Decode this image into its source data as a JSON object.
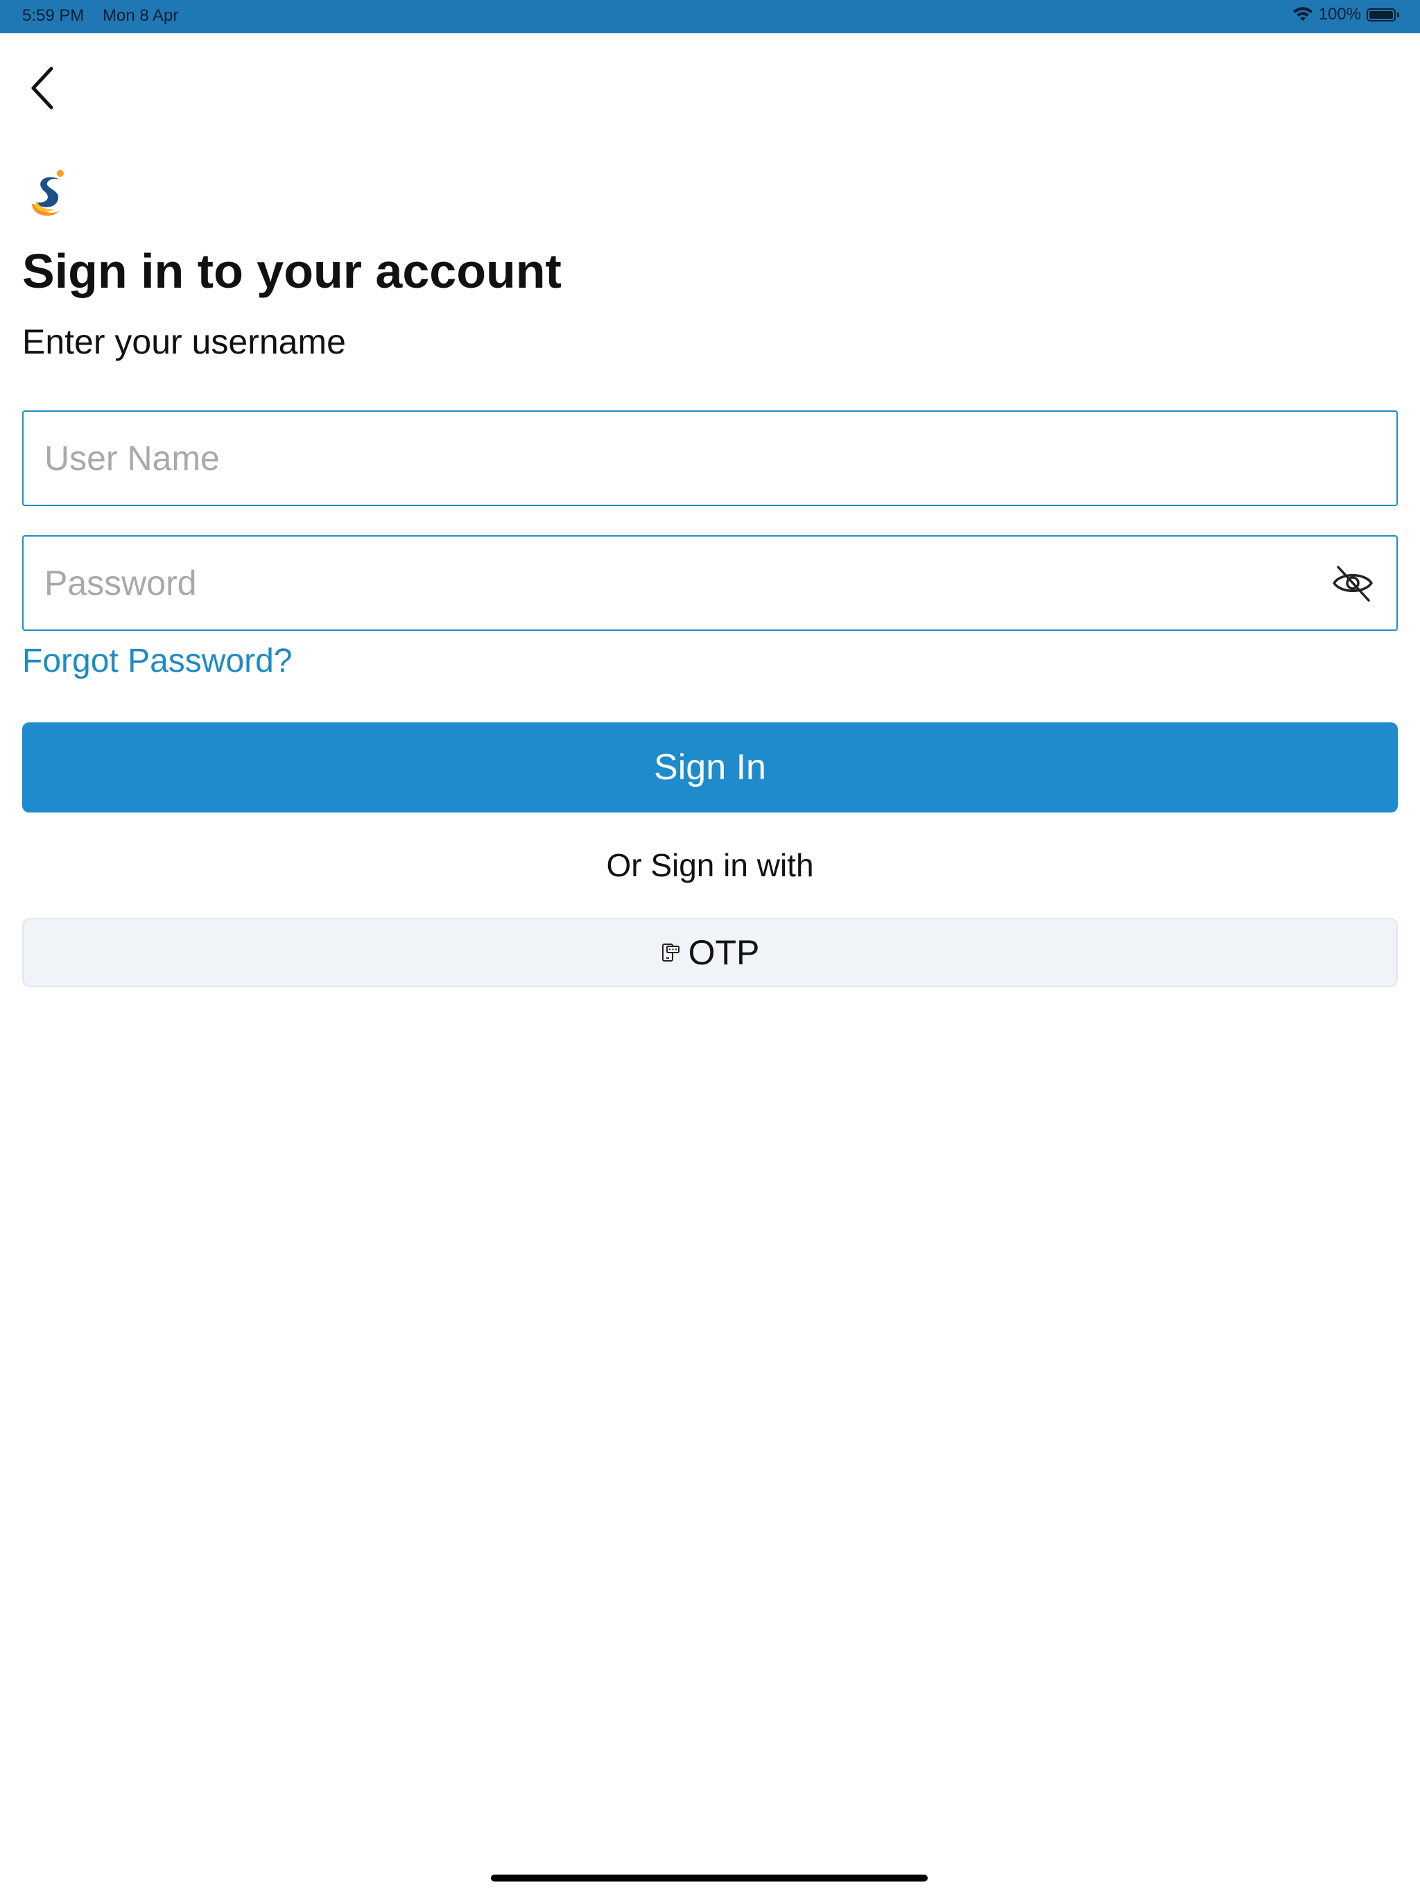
{
  "status_bar": {
    "time": "5:59 PM",
    "date": "Mon 8 Apr",
    "battery": "100%",
    "icons": [
      "wifi-icon",
      "battery-icon"
    ]
  },
  "header": {
    "back_icon": "chevron-left-icon",
    "logo_icon": "app-logo"
  },
  "login": {
    "title": "Sign in to your account",
    "subtitle": "Enter your username",
    "username_placeholder": "User Name",
    "username_value": "",
    "password_placeholder": "Password",
    "password_value": "",
    "password_toggle_icon": "eye-off-icon",
    "forgot_label": "Forgot Password?",
    "signin_label": "Sign In",
    "or_label": "Or Sign in with",
    "otp_label": "OTP",
    "otp_icon": "otp-phone-icon"
  },
  "colors": {
    "status_bar": "#1f78b4",
    "accent": "#1e8bcc",
    "link": "#1e8bc3",
    "otp_bg": "#f0f3f7"
  }
}
